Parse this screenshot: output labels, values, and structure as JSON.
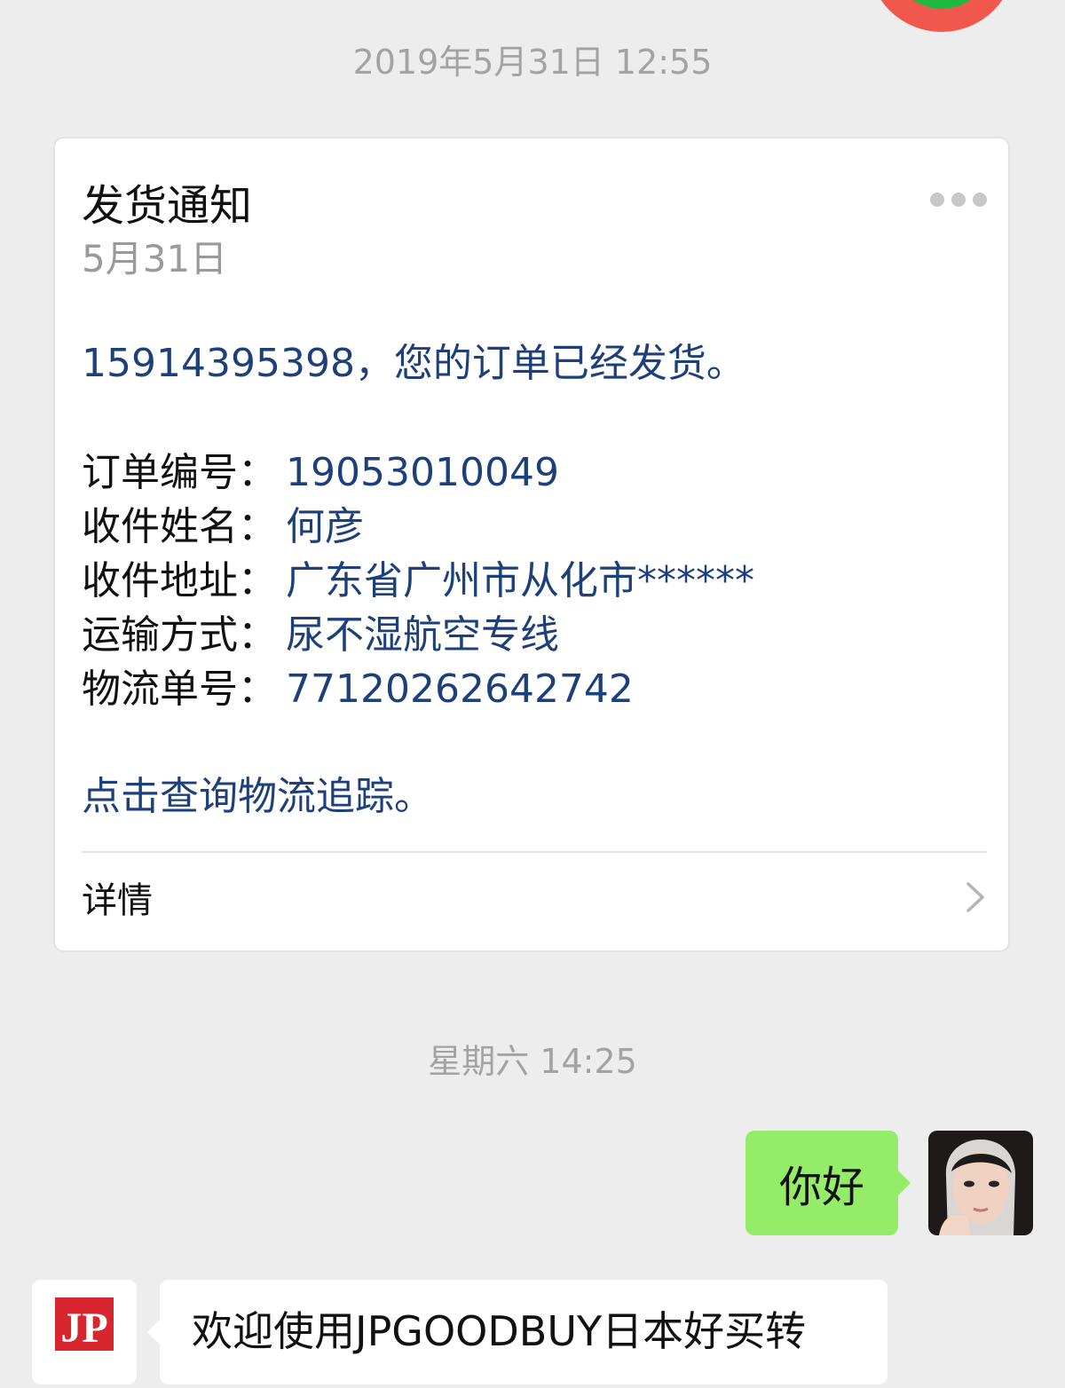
{
  "timestamps": {
    "first": "2019年5月31日 12:55",
    "second": "星期六 14:25"
  },
  "card": {
    "title": "发货通知",
    "date": "5月31日",
    "intro": "15914395398，您的订单已经发货。",
    "fields": [
      {
        "label": "订单编号：",
        "value": "19053010049"
      },
      {
        "label": "收件姓名：",
        "value": "何彦"
      },
      {
        "label": "收件地址：",
        "value": "广东省广州市从化市******"
      },
      {
        "label": "运输方式：",
        "value": "尿不湿航空专线"
      },
      {
        "label": "物流单号：",
        "value": "77120262642742"
      }
    ],
    "link_text": "点击查询物流追踪。",
    "details_label": "详情"
  },
  "messages": {
    "sent_text": "你好",
    "received_text": "欢迎使用JPGOODBUY日本好买转",
    "sender_logo_text": "JP"
  },
  "colors": {
    "background": "#ededed",
    "sent_bubble": "#95ec69",
    "link_blue": "#1d3f7a",
    "logo_red": "#d8262e"
  }
}
